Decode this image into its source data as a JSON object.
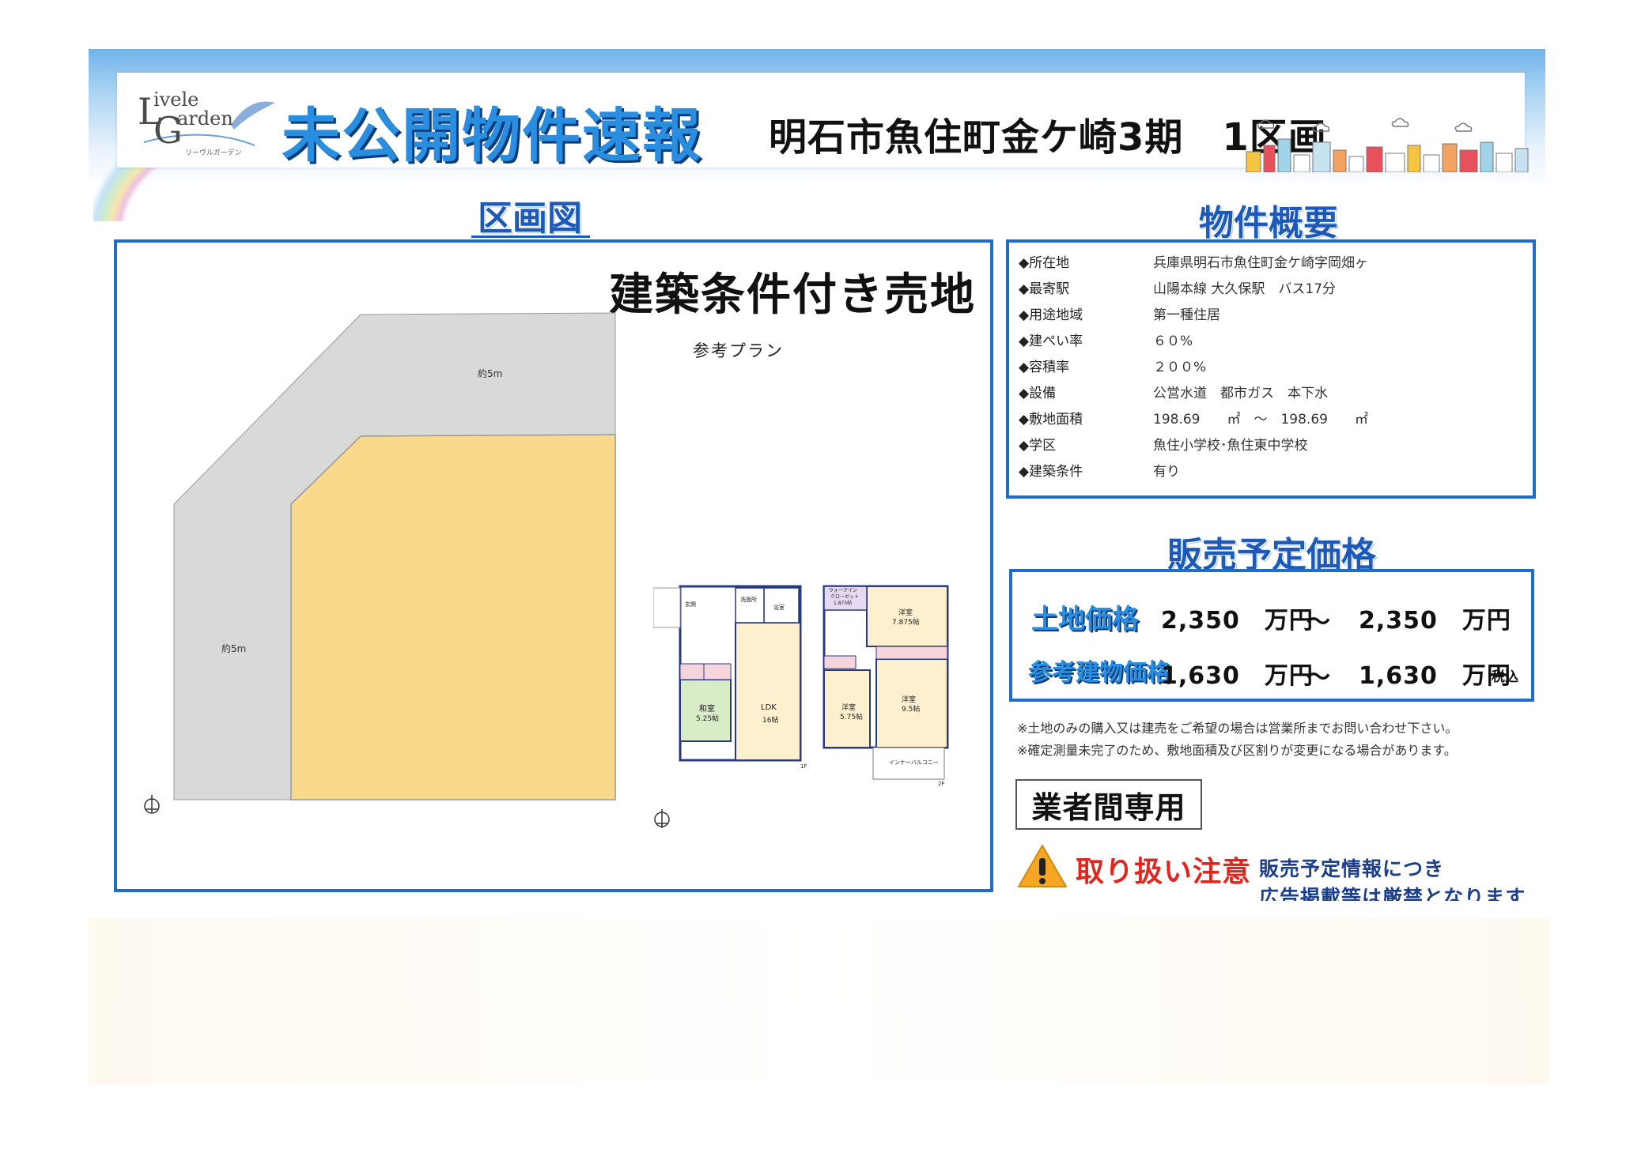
{
  "header": {
    "logo_line1": "ivele",
    "logo_line2": "arden",
    "logo_letter_l": "L",
    "logo_letter_g": "G",
    "logo_sub": "リーヴルガーデン",
    "headline": "未公開物件速報",
    "property_name": "明石市魚住町金ケ崎3期　1区画"
  },
  "plot": {
    "heading": "区画図",
    "title": "建築条件付き売地",
    "plan_label": "参考プラン",
    "road_top_label": "約5m",
    "road_left_label": "約5m",
    "floorplan_1f": {
      "rooms": [
        "玄関",
        "洗面所",
        "浴室",
        "和室",
        "5.25帖",
        "LDK",
        "16帖"
      ],
      "floor": "1F"
    },
    "floorplan_2f": {
      "rooms": [
        "ウォークイン",
        "クローゼット",
        "1.875帖",
        "洋室",
        "7.875帖",
        "洋室",
        "5.75帖",
        "洋室",
        "9.5帖",
        "インナーバルコニー"
      ],
      "floor": "2F"
    }
  },
  "summary": {
    "heading": "物件概要",
    "rows": [
      {
        "key": "◆所在地",
        "value": "兵庫県明石市魚住町金ケ崎字岡畑ヶ"
      },
      {
        "key": "◆最寄駅",
        "value": "山陽本線 大久保駅　バス17分"
      },
      {
        "key": "◆用途地域",
        "value": "第一種住居"
      },
      {
        "key": "◆建ぺい率",
        "value": "６０%"
      },
      {
        "key": "◆容積率",
        "value": "２００%"
      },
      {
        "key": "◆設備",
        "value": "公営水道　都市ガス　本下水"
      },
      {
        "key": "◆敷地面積",
        "value": "198.69　　㎡　～　198.69　　㎡"
      },
      {
        "key": "◆学区",
        "value": "魚住小学校･魚住東中学校"
      },
      {
        "key": "◆建築条件",
        "value": "有り"
      }
    ]
  },
  "price": {
    "heading": "販売予定価格",
    "land_label": "土地価格",
    "land_from": "2,350　万円",
    "land_sep": "～",
    "land_to": "2,350　万円",
    "building_label": "参考建物価格",
    "building_from": "1,630　万円",
    "building_sep": "～",
    "building_to": "1,630　万円",
    "tax_note": "税込"
  },
  "notes": [
    "※土地のみの購入又は建売をご希望の場合は営業所までお問い合わせ下さい。",
    "※確定測量未完了のため、敷地面積及び区割りが変更になる場合があります。"
  ],
  "dealer_label": "業者間専用",
  "warning": {
    "title": "取り扱い注意",
    "line1": "販売予定情報につき",
    "line2": "広告掲載等は厳禁となります"
  },
  "colors": {
    "accent_blue": "#1f6dc8",
    "lot_fill": "#f9d98c",
    "road_fill": "#d9d9d9",
    "warning_red": "#e0261e"
  }
}
